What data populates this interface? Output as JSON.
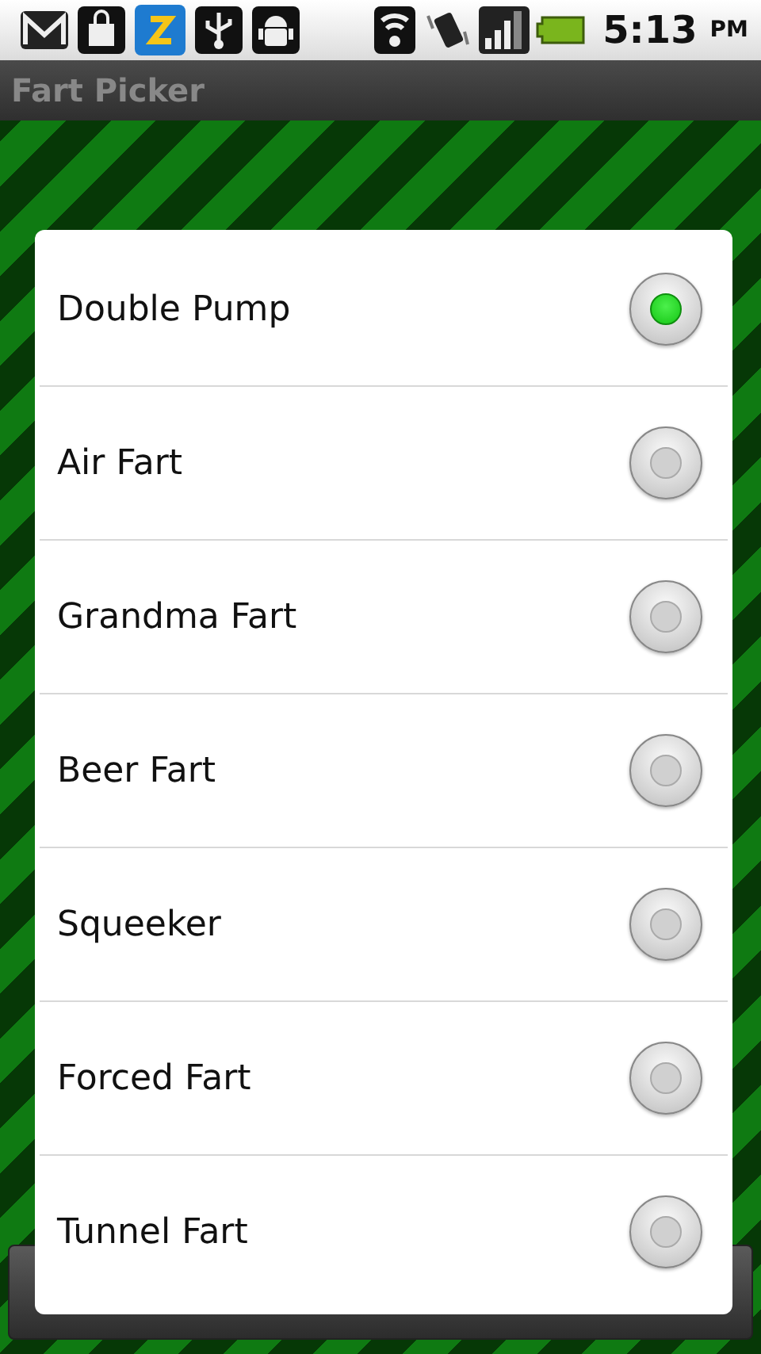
{
  "status_bar": {
    "time": "5:13",
    "period": "PM"
  },
  "title_bar": {
    "title": "Fart Picker"
  },
  "options": [
    {
      "label": "Double Pump",
      "selected": true
    },
    {
      "label": "Air Fart",
      "selected": false
    },
    {
      "label": "Grandma Fart",
      "selected": false
    },
    {
      "label": "Beer Fart",
      "selected": false
    },
    {
      "label": "Squeeker",
      "selected": false
    },
    {
      "label": "Forced Fart",
      "selected": false
    },
    {
      "label": "Tunnel Fart",
      "selected": false
    }
  ]
}
